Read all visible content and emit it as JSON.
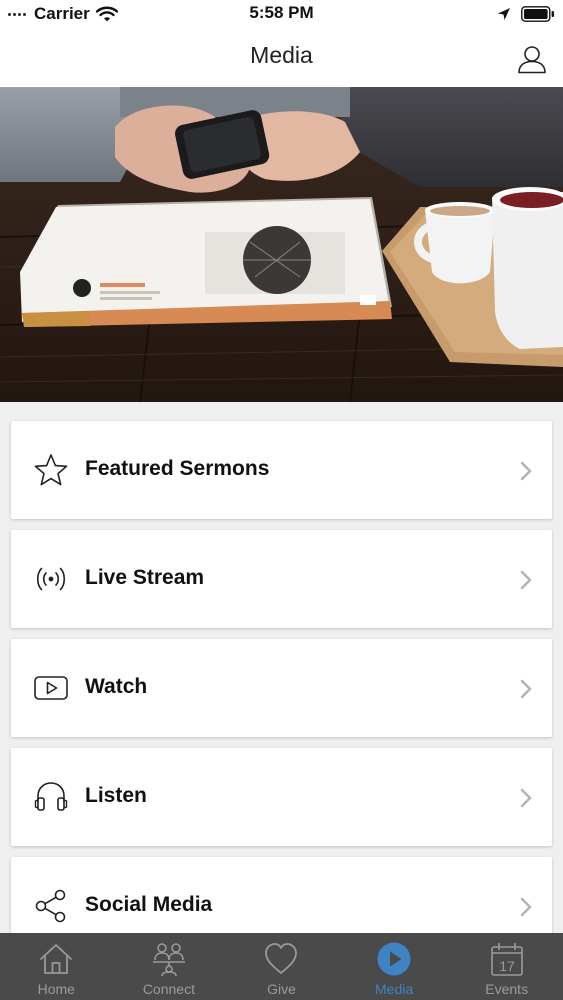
{
  "status_bar": {
    "carrier": "Carrier",
    "time": "5:58 PM"
  },
  "header": {
    "title": "Media"
  },
  "menu": [
    {
      "label": "Featured Sermons",
      "icon": "star-icon"
    },
    {
      "label": "Live Stream",
      "icon": "broadcast-icon"
    },
    {
      "label": "Watch",
      "icon": "play-box-icon"
    },
    {
      "label": "Listen",
      "icon": "headphones-icon"
    },
    {
      "label": "Social Media",
      "icon": "share-icon"
    }
  ],
  "tabs": [
    {
      "label": "Home",
      "icon": "home-icon"
    },
    {
      "label": "Connect",
      "icon": "people-icon"
    },
    {
      "label": "Give",
      "icon": "heart-icon"
    },
    {
      "label": "Media",
      "icon": "play-circle-icon",
      "active": true
    },
    {
      "label": "Events",
      "icon": "calendar-icon",
      "day": "17"
    }
  ],
  "colors": {
    "accent": "#3e83c3",
    "tab_bar": "#4a4a4a",
    "inactive": "#9a9a9a"
  }
}
